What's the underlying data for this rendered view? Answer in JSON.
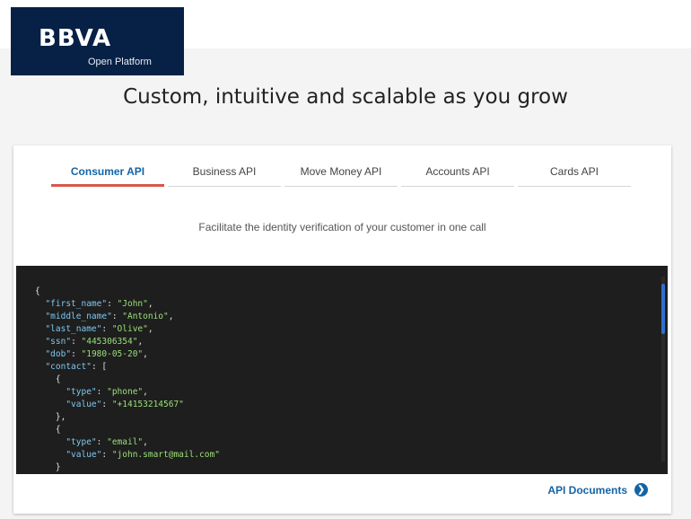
{
  "brand": {
    "name": "BBVA",
    "subtitle": "Open Platform"
  },
  "headline": "Custom, intuitive and scalable as you grow",
  "tabs": [
    {
      "label": "Consumer API",
      "active": true
    },
    {
      "label": "Business API",
      "active": false
    },
    {
      "label": "Move Money API",
      "active": false
    },
    {
      "label": "Accounts API",
      "active": false
    },
    {
      "label": "Cards API",
      "active": false
    }
  ],
  "description": "Facilitate the identity verification of your customer in one call",
  "code": {
    "open": "{",
    "first_name_key": "\"first_name\"",
    "first_name_val": "\"John\"",
    "middle_name_key": "\"middle_name\"",
    "middle_name_val": "\"Antonio\"",
    "last_name_key": "\"last_name\"",
    "last_name_val": "\"Olive\"",
    "ssn_key": "\"ssn\"",
    "ssn_val": "\"445306354\"",
    "dob_key": "\"dob\"",
    "dob_val": "\"1980-05-20\"",
    "contact_key": "\"contact\"",
    "c1_type_key": "\"type\"",
    "c1_type_val": "\"phone\"",
    "c1_value_key": "\"value\"",
    "c1_value_val": "\"+14153214567\"",
    "c2_type_key": "\"type\"",
    "c2_type_val": "\"email\"",
    "c2_value_key": "\"value\"",
    "c2_value_val": "\"john.smart@mail.com\""
  },
  "docs_link": {
    "label": "API Documents",
    "icon": "chevron-right-icon"
  },
  "colors": {
    "brand_navy": "#072146",
    "link_blue": "#1464a5",
    "active_tab_underline": "#d9564b",
    "code_bg": "#1e1e1e"
  }
}
